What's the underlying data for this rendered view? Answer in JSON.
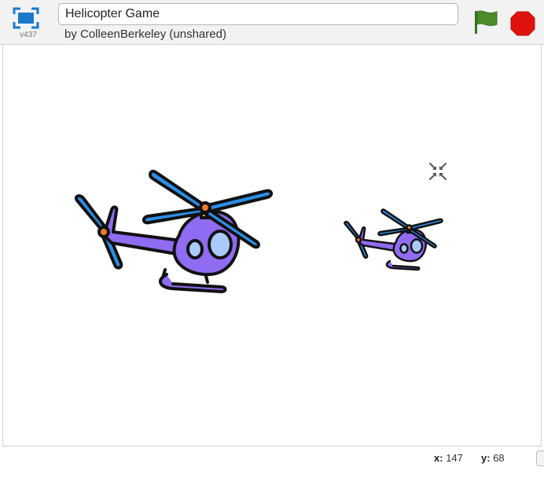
{
  "header": {
    "version": "v437",
    "project_title": "Helicopter Game",
    "byline": "by ColleenBerkeley (unshared)"
  },
  "stage": {
    "sprites": [
      {
        "name": "Helicopter"
      },
      {
        "name": "Helicopter2"
      }
    ]
  },
  "status": {
    "x_label": "x:",
    "x_value": "147",
    "y_label": "y:",
    "y_value": "68"
  },
  "colors": {
    "flag": "#4c8c2b",
    "stop": "#e0120f",
    "fullscreen_blue": "#1a7ac9",
    "helicopter_body": "#8f6cf2",
    "rotor_blue": "#2d8fe8"
  },
  "icons": {
    "fullscreen": "fullscreen-icon",
    "flag": "green-flag-icon",
    "stop": "stop-icon",
    "shrink": "shrink-icon"
  }
}
